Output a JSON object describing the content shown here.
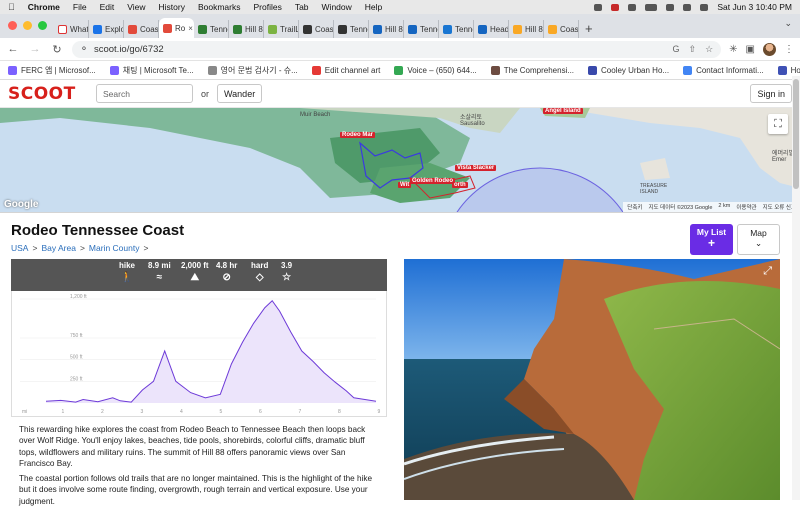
{
  "menubar": {
    "app": "Chrome",
    "items": [
      "File",
      "Edit",
      "View",
      "History",
      "Bookmarks",
      "Profiles",
      "Tab",
      "Window",
      "Help"
    ],
    "datetime": "Sat Jun 3  10:40 PM"
  },
  "tabs": [
    {
      "label": "What",
      "color": "#fff",
      "icon": "gmail-icon"
    },
    {
      "label": "Explor",
      "color": "#1a73e8",
      "icon": "word-icon"
    },
    {
      "label": "Coast",
      "color": "#e24a3b",
      "icon": "scoot-icon"
    },
    {
      "label": "Ro",
      "color": "#e24a3b",
      "icon": "scoot-icon",
      "active": true
    },
    {
      "label": "Tenne",
      "color": "#2e7d32",
      "icon": "trail-icon"
    },
    {
      "label": "Hill 8",
      "color": "#2e7d32",
      "icon": "trail-icon"
    },
    {
      "label": "TrailLi",
      "color": "#7cb342",
      "icon": "traillink-icon"
    },
    {
      "label": "Coast",
      "color": "#333",
      "icon": "mountain-icon"
    },
    {
      "label": "Tenne",
      "color": "#333",
      "icon": "mountain-icon"
    },
    {
      "label": "Hill 8",
      "color": "#1565c0",
      "icon": "mountain-icon"
    },
    {
      "label": "Tenne",
      "color": "#1565c0",
      "icon": "w-icon"
    },
    {
      "label": "Tenne",
      "color": "#1976d2",
      "icon": "w-icon"
    },
    {
      "label": "Headl",
      "color": "#1565c0",
      "icon": "wordpress-icon"
    },
    {
      "label": "Hill 8",
      "color": "#f9a825",
      "icon": "close-badge-icon"
    },
    {
      "label": "Coast",
      "color": "#f9a825",
      "icon": "warning-icon"
    }
  ],
  "omnibar": {
    "url": "scoot.io/go/6732"
  },
  "bookmarks": [
    {
      "label": "FERC 앱 | Microsof...",
      "color": "#7b61ff"
    },
    {
      "label": "채팅 | Microsoft Te...",
      "color": "#7b61ff"
    },
    {
      "label": "영어 문법 검사기 - 슈...",
      "color": "#888"
    },
    {
      "label": "Edit channel art",
      "color": "#e53935"
    },
    {
      "label": "Voice – (650) 644...",
      "color": "#34a853"
    },
    {
      "label": "The Comprehensi...",
      "color": "#6d4c41"
    },
    {
      "label": "Cooley Urban Ho...",
      "color": "#3949ab"
    },
    {
      "label": "Contact Informati...",
      "color": "#4285f4"
    },
    {
      "label": "Home - Weeks",
      "color": "#3f51b5"
    }
  ],
  "header": {
    "logo": "SCOOT",
    "search_placeholder": "Search",
    "or": "or",
    "wander": "Wander",
    "signin": "Sign in"
  },
  "map": {
    "labels": [
      "Angel Island",
      "Rodeo Mar",
      "Vista Slacker",
      "Golden Rodeo",
      "Wit",
      "orth"
    ],
    "places": [
      "Muir Beach",
      "소살리토 Sausalito",
      "TREASURE ISLAND",
      "에머리빌 Emer"
    ],
    "google": "Google",
    "attribution": [
      "단축키",
      "지도 데이터 ©2023 Google",
      "2 km",
      "이용약관",
      "지도 오류 신고"
    ]
  },
  "trail": {
    "title": "Rodeo Tennessee Coast",
    "breadcrumbs": [
      "USA",
      "Bay Area",
      "Marin County"
    ],
    "separator": ">",
    "mylist": "My List",
    "mylist_plus": "+",
    "map_btn": "Map",
    "map_chevron": "⌄"
  },
  "stats": [
    {
      "label": "hike",
      "icon": "hiker-icon",
      "glyph": "🚶"
    },
    {
      "label": "8.9 mi",
      "icon": "route-icon",
      "glyph": "≈"
    },
    {
      "label": "2,000 ft",
      "icon": "elevation-icon",
      "glyph": "⛰"
    },
    {
      "label": "4.8 hr",
      "icon": "compass-icon",
      "glyph": "⊘"
    },
    {
      "label": "hard",
      "icon": "diamond-icon",
      "glyph": "◇"
    },
    {
      "label": "3.9",
      "icon": "star-icon",
      "glyph": "☆"
    }
  ],
  "chart_data": {
    "type": "area",
    "y_ticks": [
      "1,200 ft",
      "750 ft",
      "500 ft",
      "250 ft"
    ],
    "x_ticks": [
      "mi",
      "1",
      "2",
      "3",
      "4",
      "5",
      "6",
      "7",
      "8",
      "9"
    ],
    "ylim": [
      0,
      1200
    ],
    "xlim": [
      0,
      8.9
    ],
    "x": [
      0,
      0.4,
      0.8,
      1.0,
      1.4,
      1.8,
      2.0,
      2.3,
      2.6,
      2.9,
      3.2,
      3.5,
      3.9,
      4.3,
      4.7,
      5.0,
      5.3,
      5.6,
      5.9,
      6.1,
      6.3,
      6.6,
      6.9,
      7.2,
      7.5,
      7.8,
      8.1,
      8.3,
      8.6,
      8.9
    ],
    "y": [
      20,
      30,
      10,
      40,
      15,
      60,
      25,
      10,
      150,
      250,
      600,
      250,
      120,
      60,
      100,
      450,
      700,
      920,
      1100,
      1180,
      1060,
      820,
      600,
      480,
      350,
      240,
      140,
      60,
      40,
      20
    ],
    "fill": "#ece4fb",
    "line": "#6d3ad8"
  },
  "description": [
    "This rewarding hike explores the coast from Rodeo Beach to Tennessee Beach then loops back over Wolf Ridge. You'll enjoy lakes, beaches, tide pools, shorebirds, colorful cliffs, dramatic bluff tops, wildflowers and military ruins. The summit of Hill 88 offers panoramic views over San Francisco Bay.",
    "The coastal portion follows old trails that are no longer maintained. This is the highlight of the hike but it does involve some route finding, overgrowth, rough terrain and vertical exposure. Use your judgment."
  ]
}
